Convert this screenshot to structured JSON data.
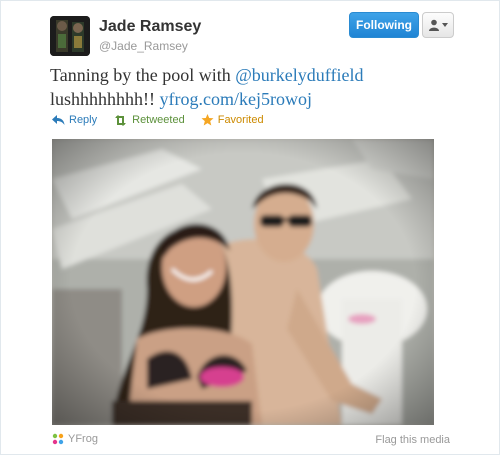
{
  "user": {
    "name": "Jade Ramsey",
    "handle": "@Jade_Ramsey",
    "avatar_icon": "avatar-photo"
  },
  "header_buttons": {
    "follow_label": "Following",
    "user_menu_icon": "user-dropdown-icon"
  },
  "tweet": {
    "text_before": "Tanning by the pool with ",
    "mention": "@burkelyduffield",
    "text_middle": "lushhhhhhhh!! ",
    "link": "yfrog.com/kej5rowoj"
  },
  "actions": {
    "reply_label": "Reply",
    "retweet_label": "Retweeted",
    "favorite_label": "Favorited"
  },
  "media": {
    "provider_label": "YFrog",
    "flag_label": "Flag this media"
  },
  "colors": {
    "link": "#2b7bb9",
    "follow_button": "#1f84d4",
    "retweet": "#5c913b",
    "favorite": "#f5a623"
  }
}
